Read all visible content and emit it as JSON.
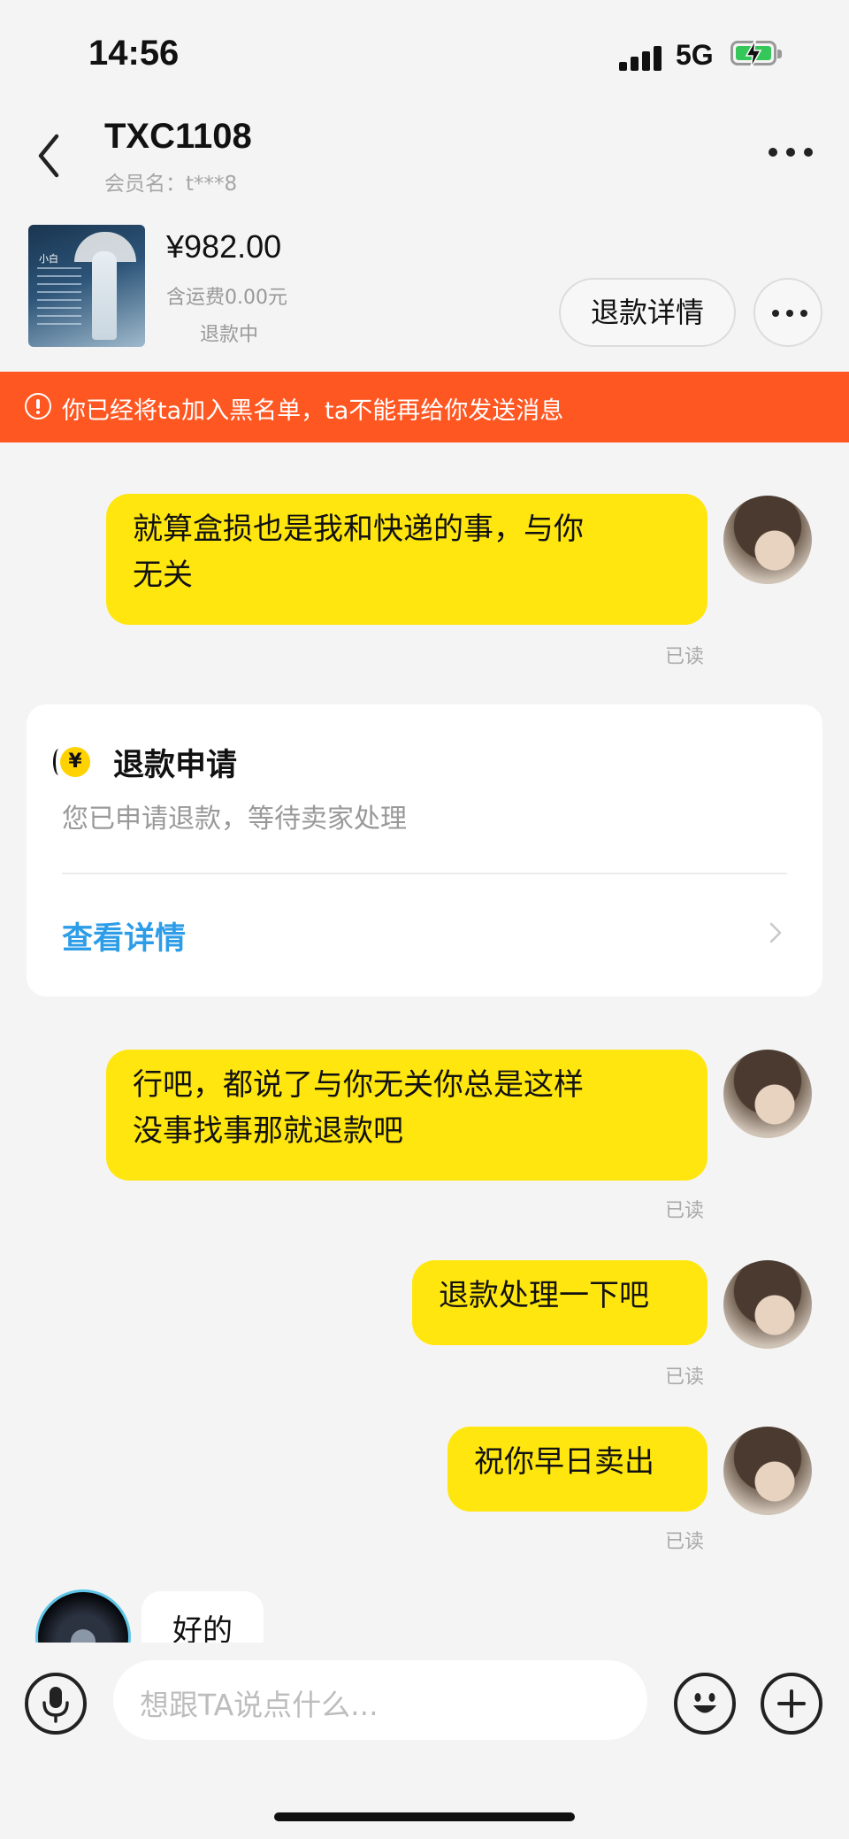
{
  "status_bar": {
    "time": "14:56",
    "network": "5G"
  },
  "nav": {
    "title": "TXC1108",
    "subtitle": "会员名：t***8"
  },
  "product": {
    "thumbnail_label": "小白",
    "price": "¥982.00",
    "shipping": "含运费0.00元",
    "status": "退款中",
    "refund_detail_label": "退款详情"
  },
  "banner": {
    "text": "你已经将ta加入黑名单，ta不能再给你发送消息"
  },
  "messages": [
    {
      "line1": "就算盒损也是我和快递的事，与你",
      "line2": "无关",
      "read": "已读"
    },
    {
      "line1": "行吧，都说了与你无关你总是这样",
      "line2": "没事找事那就退款吧",
      "read": "已读"
    },
    {
      "text": "退款处理一下吧",
      "read": "已读"
    },
    {
      "text": "祝你早日卖出",
      "read": "已读"
    }
  ],
  "refund_card": {
    "icon": "yen-icon",
    "title": "退款申请",
    "description": "您已申请退款，等待卖家处理",
    "link": "查看详情"
  },
  "incoming": {
    "text": "好的"
  },
  "input": {
    "placeholder": "想跟TA说点什么..."
  },
  "icons": [
    "back-icon",
    "more-icon",
    "warning-icon",
    "yen-icon",
    "chevron-right-icon",
    "microphone-icon",
    "emoji-icon",
    "plus-icon"
  ],
  "colors": {
    "bubble_out": "#ffe60f",
    "banner": "#ff5722",
    "link": "#2d9de8"
  }
}
